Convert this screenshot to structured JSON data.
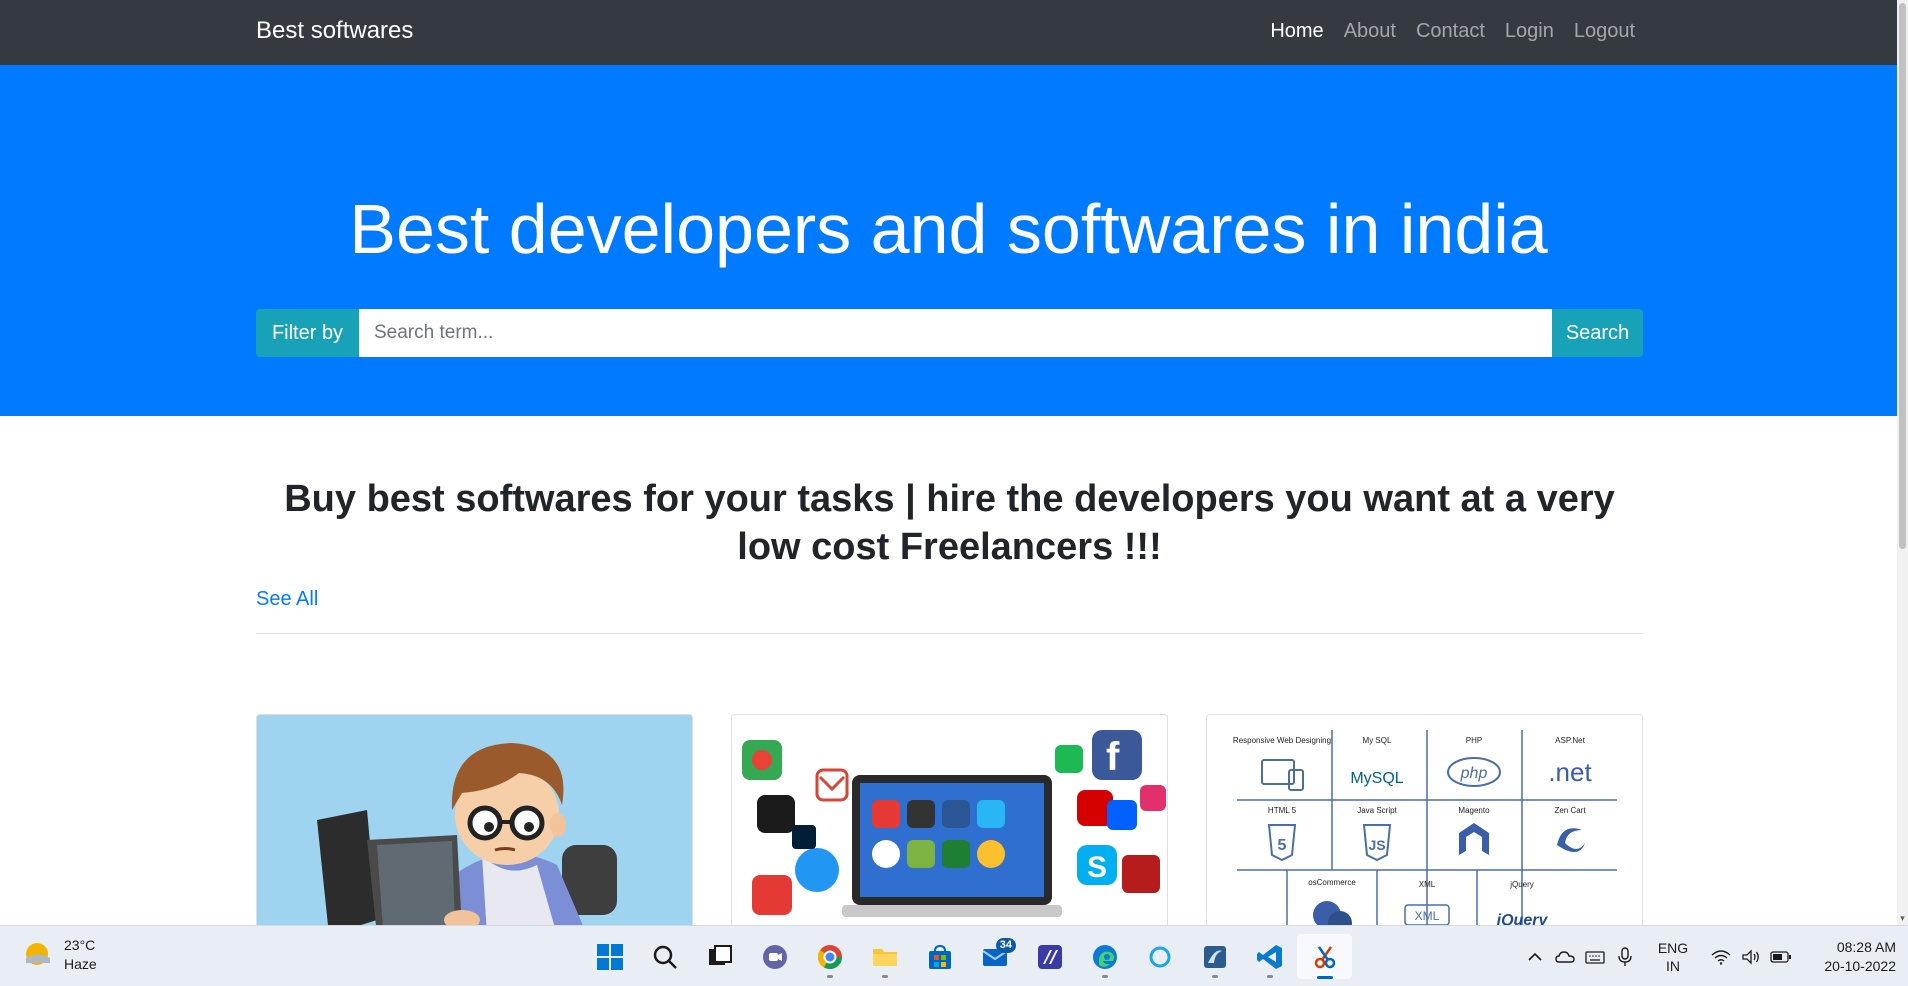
{
  "navbar": {
    "brand": "Best softwares",
    "links": [
      "Home",
      "About",
      "Contact",
      "Login",
      "Logout"
    ],
    "active": "Home"
  },
  "hero": {
    "title": "Best developers and softwares in india",
    "filter_label": "Filter by",
    "search_placeholder": "Search term...",
    "search_button": "Search"
  },
  "content": {
    "headline": "Buy best softwares for your tasks | hire the developers you want at a very low cost Freelancers !!!",
    "see_all": "See All"
  },
  "cards": [
    {
      "image": "developer-cartoon"
    },
    {
      "image": "app-icons-laptop"
    },
    {
      "image": "web-technologies-grid"
    }
  ],
  "tech_grid": {
    "row1": [
      "Responsive Web Designing",
      "My SQL",
      "PHP",
      "ASP.Net"
    ],
    "row1_logos": [
      "MySQL",
      "php",
      ".net"
    ],
    "row2": [
      "HTML 5",
      "Java Script",
      "Magento",
      "Zen Cart"
    ],
    "row3": [
      "osCommerce",
      "XML",
      "jQuery"
    ],
    "row3_logos": [
      "XML",
      "jQuery"
    ]
  },
  "taskbar": {
    "weather_temp": "23°C",
    "weather_desc": "Haze",
    "mail_badge": "34",
    "lang_line1": "ENG",
    "lang_line2": "IN",
    "time": "08:28 AM",
    "date": "20-10-2022"
  },
  "colors": {
    "navbar": "#343a40",
    "hero": "#007bff",
    "accent_button": "#17a2b8",
    "link": "#007bff"
  }
}
